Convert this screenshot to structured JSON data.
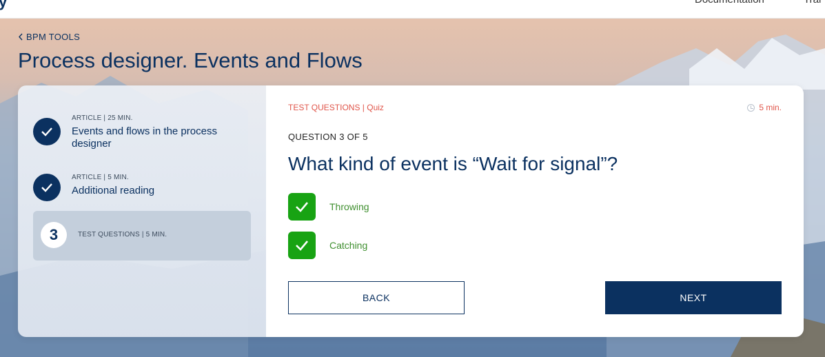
{
  "topbar": {
    "logo_fragment": "y",
    "nav": [
      "Documentation",
      "Trai"
    ]
  },
  "breadcrumb": "BPM TOOLS",
  "page_title": "Process designer. Events and Flows",
  "sidebar": {
    "steps": [
      {
        "meta": "ARTICLE | 25 MIN.",
        "label": "Events and flows in the process designer",
        "status": "completed",
        "icon": "check-icon"
      },
      {
        "meta": "ARTICLE | 5 MIN.",
        "label": "Additional reading",
        "status": "completed",
        "icon": "check-icon"
      },
      {
        "meta": "TEST QUESTIONS | 5 MIN.",
        "number": "3",
        "status": "active"
      }
    ]
  },
  "quiz": {
    "tag": "TEST QUESTIONS | Quiz",
    "duration": "5 min.",
    "question_count": "QUESTION 3 OF 5",
    "question": "What kind of event is “Wait for signal”?",
    "options": [
      {
        "label": "Throwing",
        "checked": true
      },
      {
        "label": "Catching",
        "checked": true
      }
    ],
    "back_label": "BACK",
    "next_label": "NEXT"
  },
  "colors": {
    "brand": "#0b3160",
    "accent": "#e0554a",
    "check": "#18a313",
    "option_text": "#3f8f2f"
  }
}
